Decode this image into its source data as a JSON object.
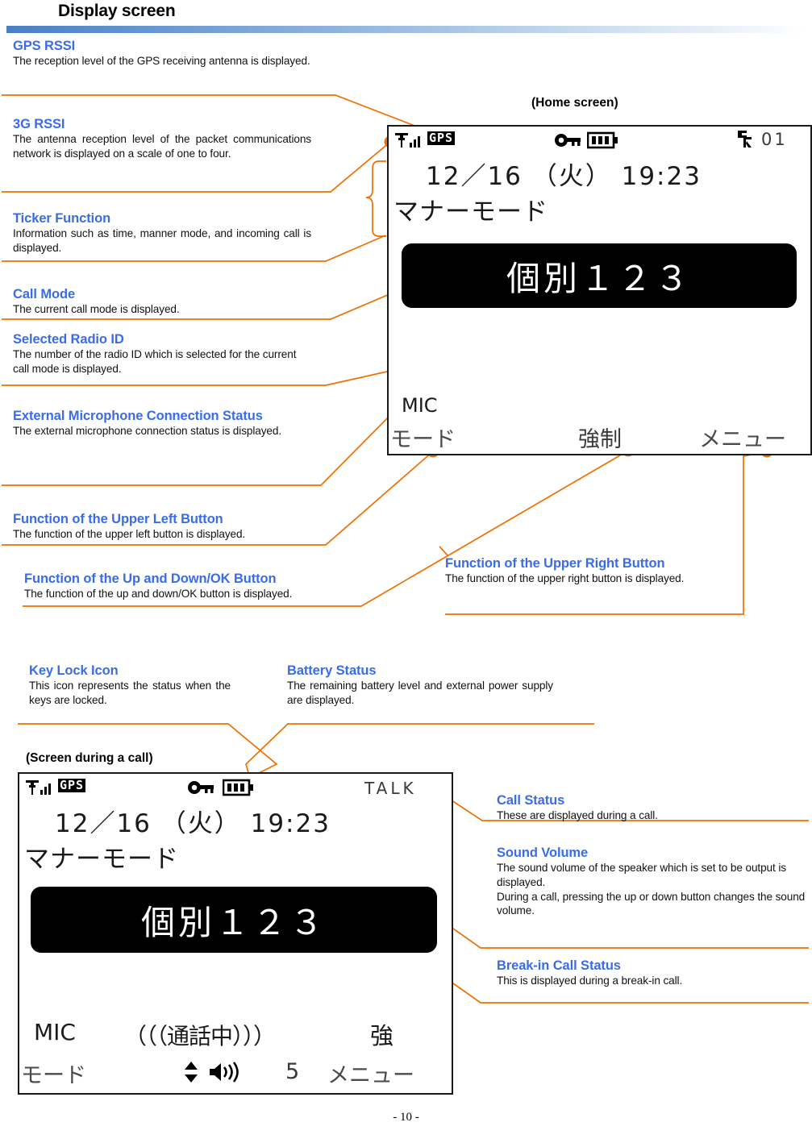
{
  "page": {
    "title": "Display screen",
    "footer": "- 10 -",
    "accent_blue": "#3a6ce8",
    "accent_orange": "#ef7000",
    "header_gradient_from": "#4a7ec4",
    "header_gradient_to": "#ffffff"
  },
  "captions": {
    "home": "(Home screen)",
    "call": "(Screen during a call)"
  },
  "notes": {
    "gps_rssi": {
      "title": "GPS RSSI",
      "body": "The reception level of the GPS receiving antenna is displayed."
    },
    "rssi_3g": {
      "title": "3G RSSI",
      "body": "The antenna reception level of the packet communications network is displayed on a scale of one to four."
    },
    "ticker": {
      "title": "Ticker Function",
      "body": "Information such as time, manner mode, and incoming call is displayed."
    },
    "call_mode": {
      "title": "Call Mode",
      "body": "The current call mode is displayed."
    },
    "radio_id": {
      "title": "Selected Radio ID",
      "body": "The number of the radio ID which is selected for the current call mode is displayed."
    },
    "ext_mic": {
      "title": "External Microphone Connection Status",
      "body": "The external microphone connection status is displayed."
    },
    "upper_left_btn": {
      "title": "Function of the Upper Left Button",
      "body": "The function of the upper left button is displayed."
    },
    "updown_ok_btn": {
      "title": "Function of the Up and Down/OK Button",
      "body": "The function of the up and down/OK button is displayed."
    },
    "upper_right_btn": {
      "title": "Function of the Upper Right Button",
      "body": "The function of the upper right button is displayed."
    },
    "key_lock": {
      "title": "Key Lock Icon",
      "body": "This icon represents the status when the keys are locked."
    },
    "battery": {
      "title": "Battery Status",
      "body": "The remaining battery level and external power supply are displayed."
    },
    "call_status": {
      "title": "Call Status",
      "body": "These are displayed during a call."
    },
    "sound_volume": {
      "title": "Sound Volume",
      "body": "The sound volume of the speaker which is set to be output is displayed.\nDuring a call, pressing the up or down button changes the sound volume."
    },
    "breakin": {
      "title": "Break-in Call Status",
      "body": "This is displayed during a break-in call."
    }
  },
  "home_screen": {
    "gps_label": "GPS",
    "group_number": "01",
    "datetime": "12／16 （火） 19:23",
    "ticker": "マナーモード",
    "selected_id": "個別１２３",
    "mic_label": "MIC",
    "softkey_left": "モード",
    "softkey_center": "強制",
    "softkey_right": "メニュー"
  },
  "call_screen": {
    "gps_label": "GPS",
    "talk_label": "TALK",
    "datetime": "12／16 （火） 19:23",
    "ticker": "マナーモード",
    "selected_id": "個別１２３",
    "mic_label": "MIC",
    "call_status_text": "（（（通話中）））",
    "breakin_text": "強",
    "volume_value": "5",
    "softkey_left": "モード",
    "softkey_right": "メニュー"
  }
}
